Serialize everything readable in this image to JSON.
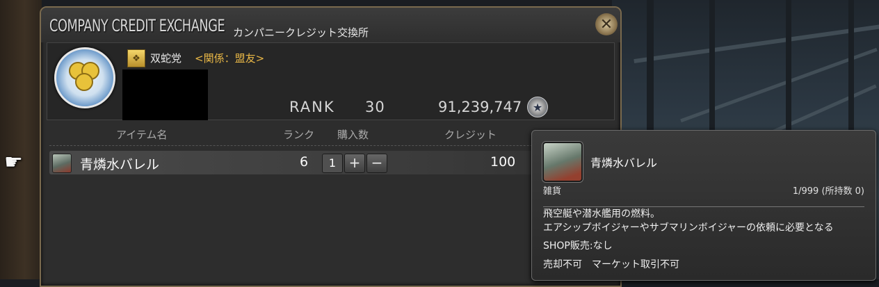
{
  "window": {
    "title_en": "COMPANY CREDIT EXCHANGE",
    "title_jp": "カンパニークレジット交換所",
    "close_icon": "close-icon"
  },
  "company": {
    "name": "双蛇党",
    "relation": "<関係：盟友>",
    "rank_label": "RANK",
    "rank_value": "30",
    "seals": "91,239,747"
  },
  "columns": {
    "item_name": "アイテム名",
    "rank": "ランク",
    "quantity": "購入数",
    "credit": "クレジット"
  },
  "rows": [
    {
      "name": "青燐水バレル",
      "rank": "6",
      "quantity": "1",
      "plus": "+",
      "minus": "−",
      "credit": "100"
    }
  ],
  "tooltip": {
    "name": "青燐水バレル",
    "category": "雑貨",
    "stock": "1/999 (所持数 0)",
    "desc_line1": "飛空艇や潜水艦用の燃料。",
    "desc_line2": "エアシップボイジャーやサブマリンボイジャーの依頼に必要となる",
    "shop": "SHOP販売:なし",
    "flags": "売却不可　マーケット取引不可"
  },
  "colors": {
    "relation": "#e7b646",
    "window_border": "#7a6a4e"
  }
}
